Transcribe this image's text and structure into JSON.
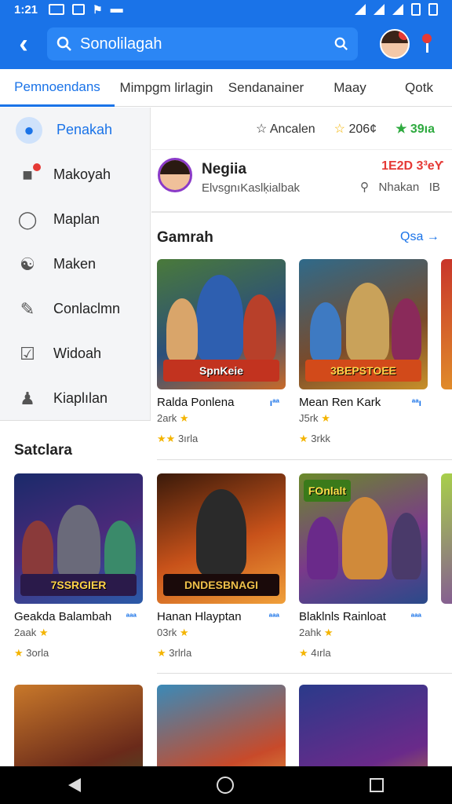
{
  "status": {
    "time": "1:21"
  },
  "appbar": {
    "search_text": "Sonolilagah"
  },
  "tabs": [
    {
      "label": "Pemnoendans"
    },
    {
      "label": "Mimpgm lirlagin"
    },
    {
      "label": "Sendanainer"
    },
    {
      "label": "Maay"
    },
    {
      "label": "Qotk"
    }
  ],
  "sidebar": {
    "items": [
      {
        "label": "Penakah",
        "icon": "profile-icon"
      },
      {
        "label": "Makoyah",
        "icon": "contacts-icon"
      },
      {
        "label": "Maplan",
        "icon": "person-icon"
      },
      {
        "label": "Maken",
        "icon": "group-icon"
      },
      {
        "label": "Conlaclmn",
        "icon": "edit-icon"
      },
      {
        "label": "Widoah",
        "icon": "checkbox-icon"
      },
      {
        "label": "Kiaplılan",
        "icon": "account-icon"
      }
    ]
  },
  "top_panel": {
    "ratings": [
      "Ancalen",
      "206¢",
      "39ıa"
    ],
    "name": "Negiia",
    "score": "1E2D 3³eƳ",
    "subtitle": "ElvsgnıKaslḳialbak",
    "search_label": "Nhakan",
    "search_extra": "IB"
  },
  "sections": {
    "featured_title": "Gamrah",
    "featured_see_all": "Qsa →",
    "second_title": "Satclara"
  },
  "featured_cards": [
    {
      "title": "Ralda Ponlena",
      "dl": "ıªª",
      "meta": "2ark",
      "rating": "3ırla",
      "banner": "SpnKeie"
    },
    {
      "title": "Mean Ren Kark",
      "dl": "ªªı",
      "meta": "J5rk",
      "rating": "3rkk",
      "banner": "3BEPSTOEE"
    }
  ],
  "grid_cards": [
    {
      "title": "Geakda Balambah",
      "dl": "ªªª",
      "meta": "2aak",
      "rating": "3orla",
      "banner": "7SSRGIER"
    },
    {
      "title": "Hanan Hlayptan",
      "dl": "ªªª",
      "meta": "03rk",
      "rating": "3rlrla",
      "banner": "DNDESBNAGI"
    },
    {
      "title": "Blaklnls Rainloat",
      "dl": "ªªª",
      "meta": "2ahk",
      "rating": "4ırla",
      "banner": "FOnlalt"
    }
  ],
  "colors": {
    "primary": "#1a73e8",
    "badge_red": "#e53935"
  }
}
